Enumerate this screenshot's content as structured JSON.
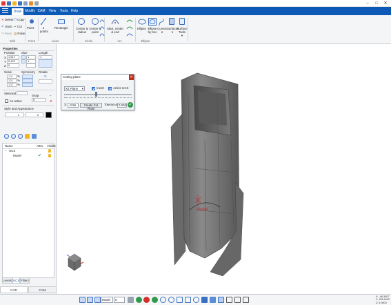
{
  "menu": {
    "items": [
      "Draw",
      "Modify",
      "CAM",
      "View",
      "Tools",
      "Help"
    ],
    "active": "Draw"
  },
  "ribbon": {
    "edit": {
      "delete": "Delete",
      "copy": "Copy",
      "undo": "Undo",
      "cut": "Cut",
      "redo": "Redo",
      "paste": "Paste",
      "group": "Edit"
    },
    "point": {
      "label": "Point",
      "group": "Point"
    },
    "lines": {
      "two_points": "2 points",
      "rectangle": "Rectangle",
      "group": "Lines"
    },
    "circle": {
      "center_radius": "Center & radius",
      "center_point": "Center & point",
      "group": "Circle"
    },
    "arc": {
      "start_center_end": "Start, center & end",
      "group": "Arc"
    },
    "ellipse": {
      "ellipse": "Ellipse",
      "ellipse_by_box": "Ellipse by box",
      "curves": "Curves",
      "surfaces": "Surfaces",
      "surface_tools": "Surface Tools",
      "group": "Ellipse"
    }
  },
  "properties": {
    "title": "Properties",
    "position": "Position",
    "size": "Size",
    "length": "Length",
    "x_value": "1.517",
    "y_value": "0.422",
    "z_value": "0",
    "size_x": "1",
    "size_y": "1",
    "length_value": "1",
    "scale": "Scale",
    "symmetry": "Symmetry",
    "rotate": "Rotate",
    "scale_values": [
      "100",
      "100",
      "100"
    ],
    "selected": "Selected",
    "snap": "Snap",
    "snap_value": "5",
    "as_active": "As active",
    "style_appearance": "Style and Appearance",
    "line_style": "1",
    "line_width": "0"
  },
  "tree": {
    "col_name": "Name",
    "col_attrs": "Attrs.",
    "col_visible": "Visible",
    "root": "UCS",
    "child": "Model"
  },
  "panel_tabs": [
    "Levels",
    "UCS",
    "Filters"
  ],
  "active_panel_tab": "UCS",
  "bottom_tabs": [
    "CAD",
    "CAM"
  ],
  "active_bottom_tab": "CAD",
  "dialog": {
    "title": "Cutting plane",
    "plane": "XZ Plane",
    "invert": "Invert",
    "active_ucs": "Active UCS",
    "x_label": "X:",
    "x_value": "-2.56",
    "create_button": "Create Cut Plane",
    "tolerance_label": "Tolerance",
    "tolerance_value": "0.002"
  },
  "viewport": {
    "model_label": "Model"
  },
  "status": {
    "mode": "Model",
    "level": "0",
    "coords": [
      "X: -46.3507",
      "Y: 153.4422",
      "Z: 0.0000"
    ]
  },
  "colors": {
    "accent": "#0c5ab5",
    "model": "#7d7d7d",
    "model_label": "#c0272d"
  }
}
